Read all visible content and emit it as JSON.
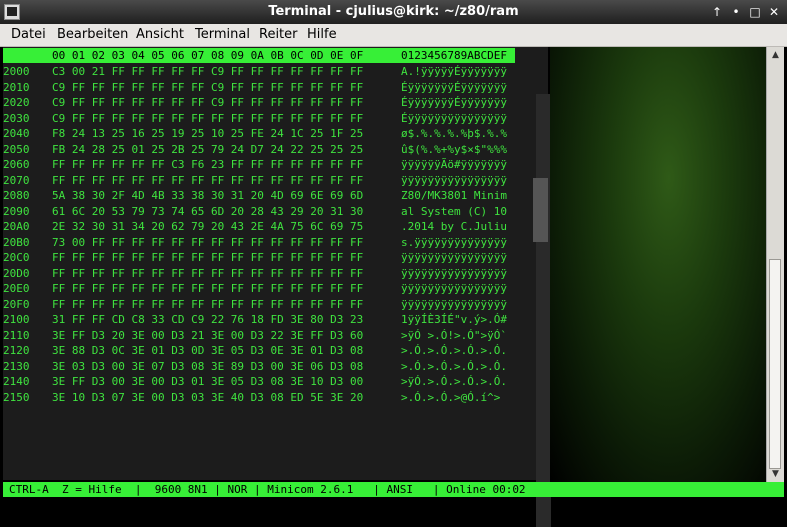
{
  "window": {
    "title": "Terminal - cjulius@kirk: ~/z80/ram"
  },
  "menu": [
    "Datei",
    "Bearbeiten",
    "Ansicht",
    "Terminal",
    "Reiter",
    "Hilfe"
  ],
  "hexdump": {
    "header_bytes": "00 01 02 03 04 05 06 07 08 09 0A 0B 0C 0D 0E 0F",
    "header_ascii": "0123456789ABCDEF",
    "rows": [
      {
        "addr": "2000",
        "hex": "C3 00 21 FF FF FF FF FF C9 FF FF FF FF FF FF FF",
        "ascii": "A.!ÿÿÿÿÿÉÿÿÿÿÿÿÿ"
      },
      {
        "addr": "2010",
        "hex": "C9 FF FF FF FF FF FF FF C9 FF FF FF FF FF FF FF",
        "ascii": "ÉÿÿÿÿÿÿÿÉÿÿÿÿÿÿÿ"
      },
      {
        "addr": "2020",
        "hex": "C9 FF FF FF FF FF FF FF C9 FF FF FF FF FF FF FF",
        "ascii": "ÉÿÿÿÿÿÿÿÉÿÿÿÿÿÿÿ"
      },
      {
        "addr": "2030",
        "hex": "C9 FF FF FF FF FF FF FF FF FF FF FF FF FF FF FF",
        "ascii": "Éÿÿÿÿÿÿÿÿÿÿÿÿÿÿÿ"
      },
      {
        "addr": "2040",
        "hex": "F8 24 13 25 16 25 19 25 10 25 FE 24 1C 25 1F 25",
        "ascii": "ø$.%.%.%.%þ$.%.%"
      },
      {
        "addr": "2050",
        "hex": "FB 24 28 25 01 25 2B 25 79 24 D7 24 22 25 25 25",
        "ascii": "û$(%.%+%y$×$\"%%%"
      },
      {
        "addr": "2060",
        "hex": "FF FF FF FF FF FF C3 F6 23 FF FF FF FF FF FF FF",
        "ascii": "ÿÿÿÿÿÿÃö#ÿÿÿÿÿÿÿ"
      },
      {
        "addr": "2070",
        "hex": "FF FF FF FF FF FF FF FF FF FF FF FF FF FF FF FF",
        "ascii": "ÿÿÿÿÿÿÿÿÿÿÿÿÿÿÿÿ"
      },
      {
        "addr": "2080",
        "hex": "5A 38 30 2F 4D 4B 33 38 30 31 20 4D 69 6E 69 6D",
        "ascii": "Z80/MK3801 Minim"
      },
      {
        "addr": "2090",
        "hex": "61 6C 20 53 79 73 74 65 6D 20 28 43 29 20 31 30",
        "ascii": "al System (C) 10"
      },
      {
        "addr": "20A0",
        "hex": "2E 32 30 31 34 20 62 79 20 43 2E 4A 75 6C 69 75",
        "ascii": ".2014 by C.Juliu"
      },
      {
        "addr": "20B0",
        "hex": "73 00 FF FF FF FF FF FF FF FF FF FF FF FF FF FF",
        "ascii": "s.ÿÿÿÿÿÿÿÿÿÿÿÿÿÿ"
      },
      {
        "addr": "20C0",
        "hex": "FF FF FF FF FF FF FF FF FF FF FF FF FF FF FF FF",
        "ascii": "ÿÿÿÿÿÿÿÿÿÿÿÿÿÿÿÿ"
      },
      {
        "addr": "20D0",
        "hex": "FF FF FF FF FF FF FF FF FF FF FF FF FF FF FF FF",
        "ascii": "ÿÿÿÿÿÿÿÿÿÿÿÿÿÿÿÿ"
      },
      {
        "addr": "20E0",
        "hex": "FF FF FF FF FF FF FF FF FF FF FF FF FF FF FF FF",
        "ascii": "ÿÿÿÿÿÿÿÿÿÿÿÿÿÿÿÿ"
      },
      {
        "addr": "20F0",
        "hex": "FF FF FF FF FF FF FF FF FF FF FF FF FF FF FF FF",
        "ascii": "ÿÿÿÿÿÿÿÿÿÿÿÿÿÿÿÿ"
      },
      {
        "addr": "2100",
        "hex": "31 FF FF CD C8 33 CD C9 22 76 18 FD 3E 80 D3 23",
        "ascii": "1ÿÿÍÈ3ÍÉ\"v.ý>.Ó#"
      },
      {
        "addr": "2110",
        "hex": "3E FF D3 20 3E 00 D3 21 3E 00 D3 22 3E FF D3 60",
        "ascii": ">ÿÓ >.Ó!>.Ó\">ÿÓ`"
      },
      {
        "addr": "2120",
        "hex": "3E 88 D3 0C 3E 01 D3 0D 3E 05 D3 0E 3E 01 D3 08",
        "ascii": ">.Ó.>.Ó.>.Ó.>.Ó."
      },
      {
        "addr": "2130",
        "hex": "3E 03 D3 00 3E 07 D3 08 3E 89 D3 00 3E 06 D3 08",
        "ascii": ">.Ó.>.Ó.>.Ó.>.Ó."
      },
      {
        "addr": "2140",
        "hex": "3E FF D3 00 3E 00 D3 01 3E 05 D3 08 3E 10 D3 00",
        "ascii": ">ÿÓ.>.Ó.>.Ó.>.Ó."
      },
      {
        "addr": "2150",
        "hex": "3E 10 D3 07 3E 00 D3 03 3E 40 D3 08 ED 5E 3E 20",
        "ascii": ">.Ó.>.Ó.>@Ó.í^> "
      }
    ]
  },
  "statusbar": "CTRL-A  Z = Hilfe  |  9600 8N1 | NOR | Minicom 2.6.1   | ANSI   | Online 00:02",
  "colors": {
    "terminal_fg": "#3fe33f",
    "highlight_bg": "#37ef37",
    "terminal_bg": "#1c1c1c"
  }
}
